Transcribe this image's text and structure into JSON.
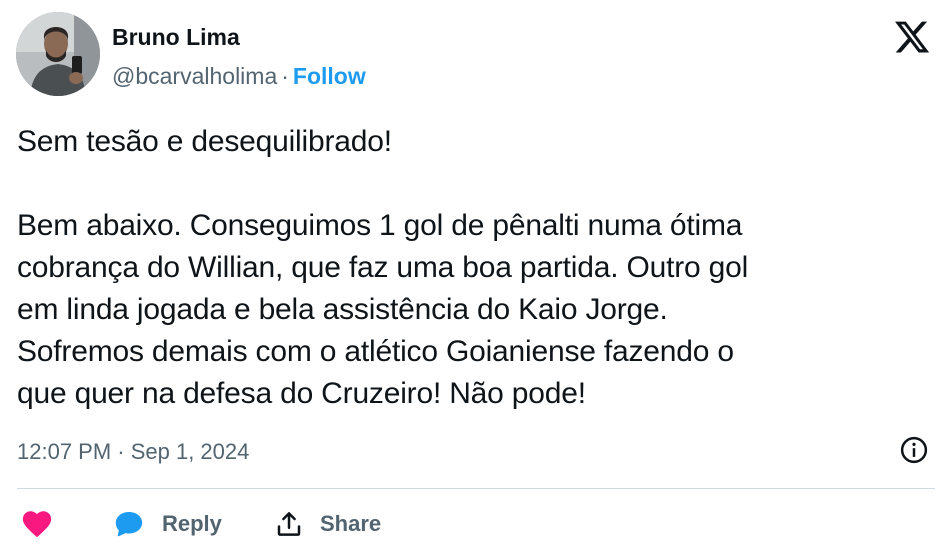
{
  "author": {
    "name": "Bruno Lima",
    "handle": "@bcarvalholima",
    "separator": "·",
    "follow_label": "Follow"
  },
  "tweet": {
    "paragraph1": [
      "Sem tesão e desequilibrado!"
    ],
    "paragraph2": [
      "Bem abaixo. Conseguimos 1 gol de pênalti numa ótima",
      "cobrança do Willian, que faz uma boa partida. Outro gol",
      "em linda jogada e bela assistência do Kaio Jorge.",
      "Sofremos demais com o atlético Goianiense fazendo o",
      "que quer na defesa do Cruzeiro! Não pode!"
    ],
    "timestamp": "12:07 PM · Sep 1, 2024"
  },
  "actions": {
    "like_icon": "heart-icon",
    "reply_label": "Reply",
    "reply_icon": "speech-bubble-icon",
    "share_label": "Share",
    "share_icon": "share-upload-icon"
  },
  "icons": {
    "brand": "x-logo-icon",
    "info": "info-icon"
  },
  "colors": {
    "accent": "#1d9bf0",
    "heart": "#f91880",
    "text_primary": "#0f1419",
    "text_secondary": "#536471",
    "divider": "#cfd9de"
  }
}
